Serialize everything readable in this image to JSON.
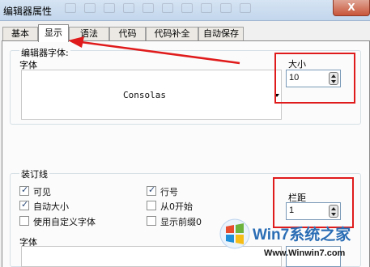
{
  "window": {
    "title": "编辑器属性",
    "close_label": "X"
  },
  "tabs": [
    {
      "label": "基本"
    },
    {
      "label": "显示"
    },
    {
      "label": "语法"
    },
    {
      "label": "代码"
    },
    {
      "label": "代码补全"
    },
    {
      "label": "自动保存"
    }
  ],
  "editor_font": {
    "group_label": "编辑器字体:",
    "font_label": "字体",
    "font_value": "Consolas",
    "size_label": "大小",
    "size_value": "10"
  },
  "gutter": {
    "group_label": "装订线",
    "checkboxes": [
      {
        "label": "可见",
        "checked": true
      },
      {
        "label": "自动大小",
        "checked": true
      },
      {
        "label": "使用自定义字体",
        "checked": false
      },
      {
        "label": "行号",
        "checked": true
      },
      {
        "label": "从0开始",
        "checked": false
      },
      {
        "label": "显示前缀0",
        "checked": false
      }
    ],
    "spacing_label": "栏距",
    "spacing_value": "1",
    "font_label": "字体"
  },
  "watermark": {
    "brand": "Win7系统之家",
    "url": "Www.Winwin7.com"
  },
  "colors": {
    "annotation_red": "#e01b1b",
    "titlebar": "#c9dcf0",
    "panel": "#fbfbfb"
  }
}
